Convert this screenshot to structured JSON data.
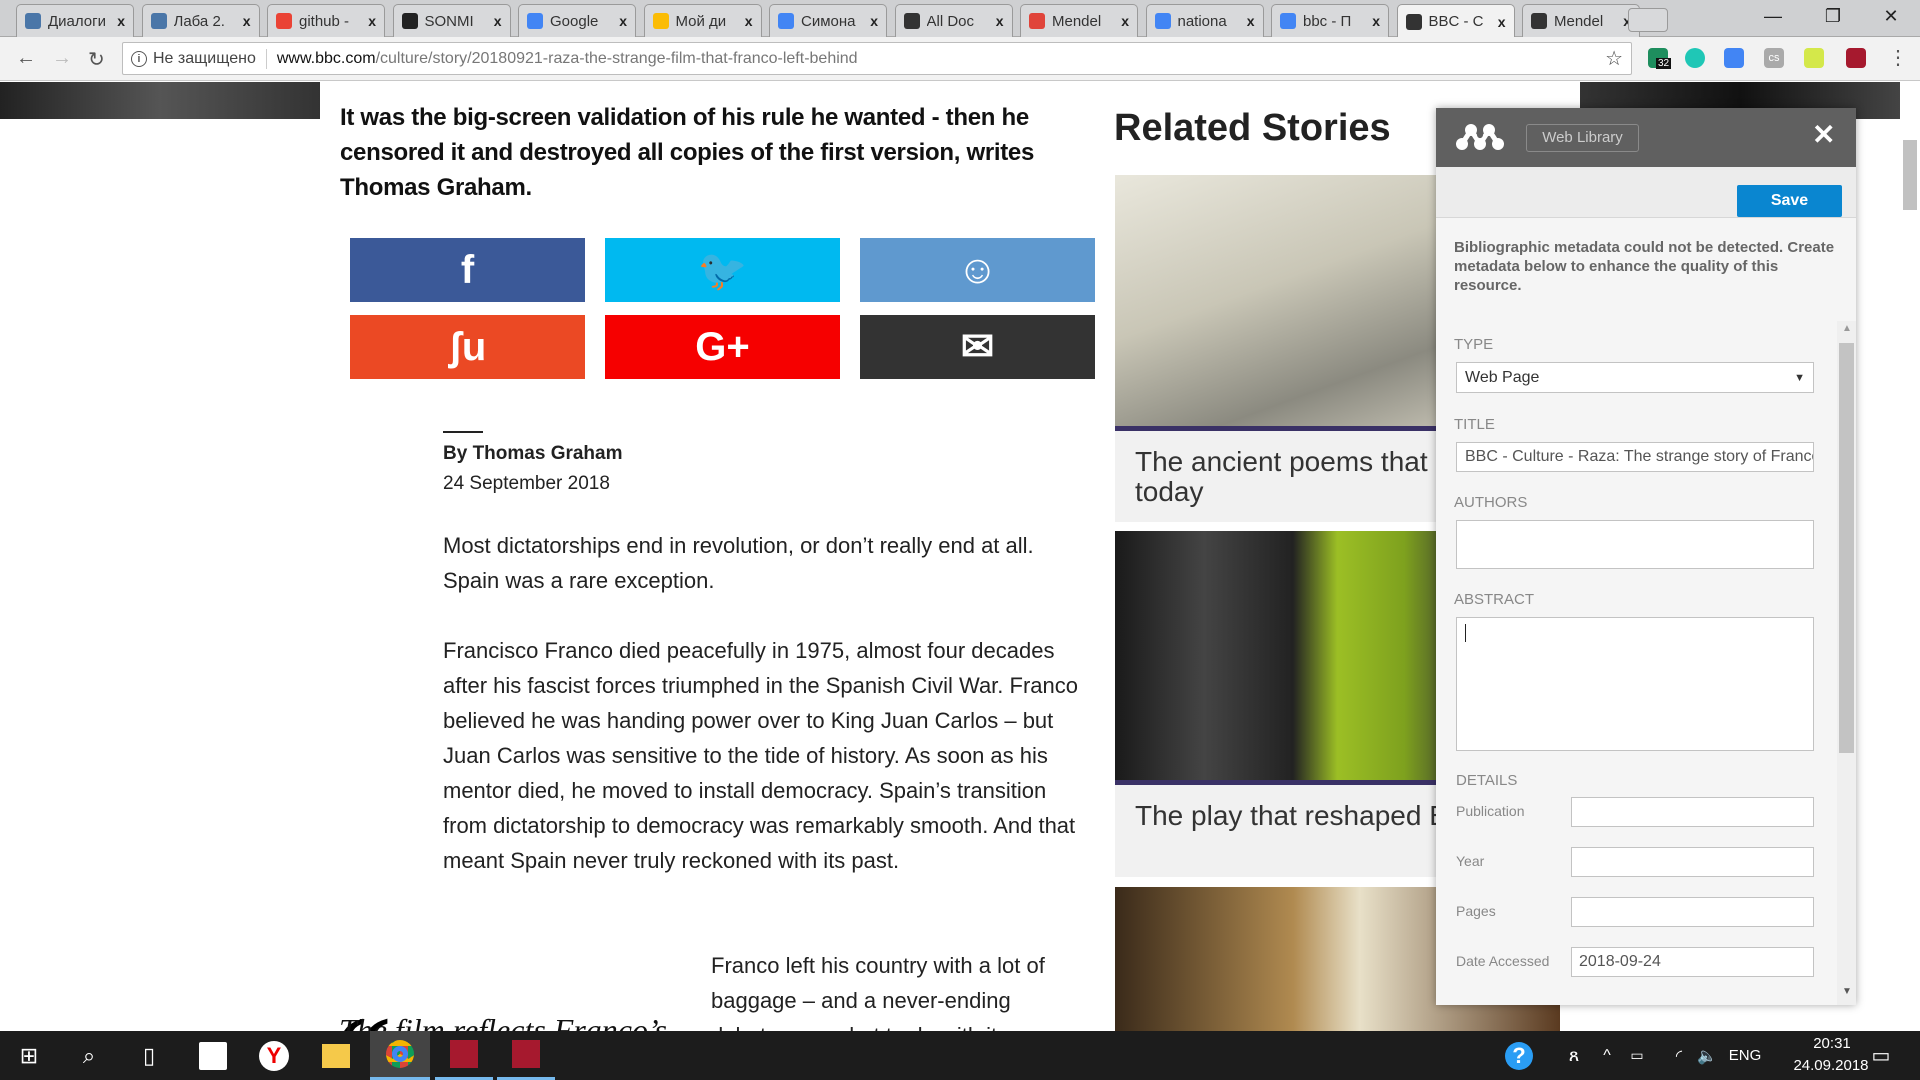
{
  "browser": {
    "tabs": [
      {
        "title": "Диалоги",
        "color": "#4a76a8",
        "close": "x"
      },
      {
        "title": "Лаба 2.",
        "color": "#4a76a8",
        "close": "x"
      },
      {
        "title": "github -",
        "color": "#ea4335",
        "close": "x"
      },
      {
        "title": "SONMI",
        "color": "#222222",
        "close": "x"
      },
      {
        "title": "Google",
        "color": "#4285f4",
        "close": "x"
      },
      {
        "title": "Мой ди",
        "color": "#fbbc05",
        "close": "x"
      },
      {
        "title": "Симона",
        "color": "#4285f4",
        "close": "x"
      },
      {
        "title": "All Doc",
        "color": "#333333",
        "close": "x"
      },
      {
        "title": "Mendel",
        "color": "#e0443a",
        "close": "x"
      },
      {
        "title": "nationa",
        "color": "#4285f4",
        "close": "x"
      },
      {
        "title": "bbc - П",
        "color": "#4285f4",
        "close": "x"
      },
      {
        "title": "BBC - C",
        "color": "#333333",
        "close": "x"
      },
      {
        "title": "Mendel",
        "color": "#333333",
        "close": "x"
      }
    ],
    "security": "Не защищено",
    "url_host": "www.bbc.com",
    "url_path": "/culture/story/20180921-raza-the-strange-film-that-franco-left-behind",
    "ext_badge": "32",
    "ext_cs": "cs"
  },
  "article": {
    "intro": "It was the big-screen validation of his rule he wanted - then he censored it and destroyed all copies of the first version, writes Thomas Graham.",
    "share": [
      {
        "name": "facebook",
        "glyph": "f",
        "color": "#3b5998"
      },
      {
        "name": "twitter",
        "glyph": "🐦",
        "color": "#00b9f0"
      },
      {
        "name": "reddit",
        "glyph": "☺",
        "color": "#5f99cf"
      },
      {
        "name": "stumbleupon",
        "glyph": "ʃu",
        "color": "#eb4924"
      },
      {
        "name": "google-plus",
        "glyph": "G+",
        "color": "#f60000"
      },
      {
        "name": "email",
        "glyph": "✉",
        "color": "#333333"
      }
    ],
    "byline": "By Thomas Graham",
    "date": "24 September 2018",
    "p1": "Most dictatorships end in revolution, or don’t really end at all. Spain was a rare exception.",
    "p2": "Francisco Franco died peacefully in 1975, almost four decades after his fascist forces triumphed in the Spanish Civil War. Franco believed he was handing power over to King Juan Carlos –  but Juan Carlos was sensitive to the tide of history. As soon as his mentor died, he moved to install democracy. Spain’s transition from dictatorship to democracy was remarkably smooth. And that meant Spain never truly reckoned with its past.",
    "quote_mark": "“",
    "pullquote": "The film reflects Franco’s",
    "p3": "Franco left his country with a lot of baggage – and a never-ending debate over what to do with it"
  },
  "related": {
    "heading": "Related Stories",
    "items": [
      {
        "title": "The ancient poems that explain today"
      },
      {
        "title": "The play that reshaped English"
      }
    ]
  },
  "mendeley": {
    "web_library": "Web Library",
    "close": "✕",
    "save": "Save",
    "message": "Bibliographic metadata could not be detected. Create metadata below to enhance the quality of this resource.",
    "type_label": "TYPE",
    "type_value": "Web Page",
    "title_label": "TITLE",
    "title_value": "BBC - Culture - Raza: The strange story of Franco's lost film",
    "authors_label": "AUTHORS",
    "abstract_label": "ABSTRACT",
    "details_label": "DETAILS",
    "details": [
      {
        "label": "Publication",
        "value": ""
      },
      {
        "label": "Year",
        "value": ""
      },
      {
        "label": "Pages",
        "value": ""
      },
      {
        "label": "Date Accessed",
        "value": "2018-09-24"
      }
    ]
  },
  "taskbar": {
    "lang": "ENG",
    "time": "20:31",
    "date": "24.09.2018"
  }
}
